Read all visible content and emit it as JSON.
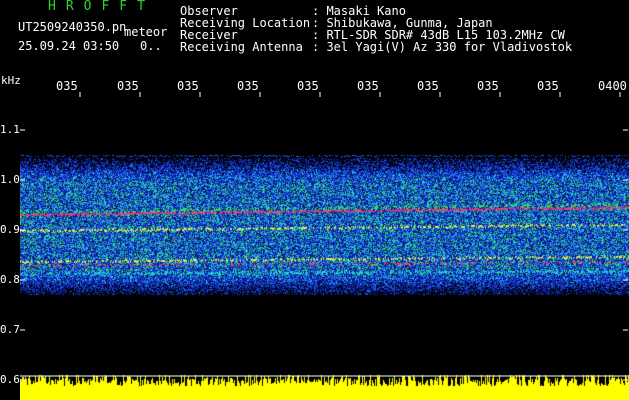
{
  "header": {
    "logo": "HROFFT",
    "filename": "UT2509240350.pn",
    "mode": "meteor",
    "datetime": "25.09.24 03:50",
    "counter": "0..",
    "info": [
      {
        "label": "Observer",
        "value": ": Masaki Kano"
      },
      {
        "label": "Receiving Location",
        "value": ": Shibukawa, Gunma, Japan"
      },
      {
        "label": "Receiver",
        "value": ": RTL-SDR SDR# 43dB L15 103.2MHz CW"
      },
      {
        "label": "Receiving Antenna",
        "value": ": 3el Yagi(V) Az 330 for Vladivostok"
      }
    ]
  },
  "axes": {
    "y_unit": "kHz",
    "y_ticks": [
      "1.1",
      "1.0",
      "0.9",
      "0.8",
      "0.7",
      "0.6"
    ],
    "x_ticks": [
      "035",
      "035",
      "035",
      "035",
      "035",
      "035",
      "035",
      "035",
      "035",
      "0400"
    ]
  },
  "colors": {
    "background": "#000000",
    "header_green": "#2bd42b",
    "waveform": "#ffff00",
    "noise_dark": "#0a1a8c",
    "noise_mid": "#1e5aff",
    "noise_cyan": "#22d3d3",
    "noise_green": "#33dd55",
    "trace_red": "#ff3366",
    "trace_yellow": "#e8e84a"
  }
}
